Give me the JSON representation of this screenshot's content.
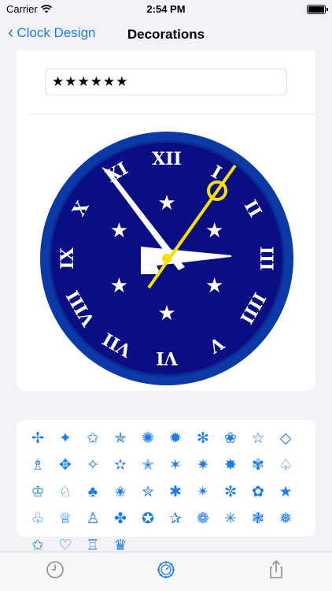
{
  "status": {
    "carrier": "Carrier",
    "time": "2:54 PM"
  },
  "nav": {
    "back_label": "Clock Design",
    "title": "Decorations"
  },
  "text_field": {
    "value": "★★★★★★"
  },
  "clock": {
    "numerals": [
      "XII",
      "I",
      "II",
      "III",
      "IIII",
      "V",
      "VI",
      "VII",
      "VIII",
      "IX",
      "X",
      "XI"
    ],
    "star_glyph": "★",
    "face_color": "#0b0e82",
    "rim_color": "#0b3aa8",
    "second_hand_color": "#f7e000"
  },
  "decorations": {
    "accent": "#1a7cf2",
    "glyphs": [
      "✢",
      "✦",
      "✩",
      "✯",
      "✺",
      "✹",
      "✻",
      "❀",
      "☆",
      "◇",
      "♗",
      "✥",
      "✧",
      "✫",
      "✭",
      "✶",
      "✷",
      "✸",
      "✾",
      "♤",
      "♔",
      "♘",
      "♣",
      "✬",
      "✮",
      "✱",
      "✴",
      "✼",
      "✿",
      "★",
      "♧",
      "♕",
      "♙",
      "✤",
      "✪",
      "✰",
      "❁",
      "✳",
      "❃",
      "❅",
      "✩",
      "♡",
      "♖",
      "♛"
    ]
  },
  "tabs": [
    "clock-tab",
    "design-tab",
    "share-tab"
  ]
}
